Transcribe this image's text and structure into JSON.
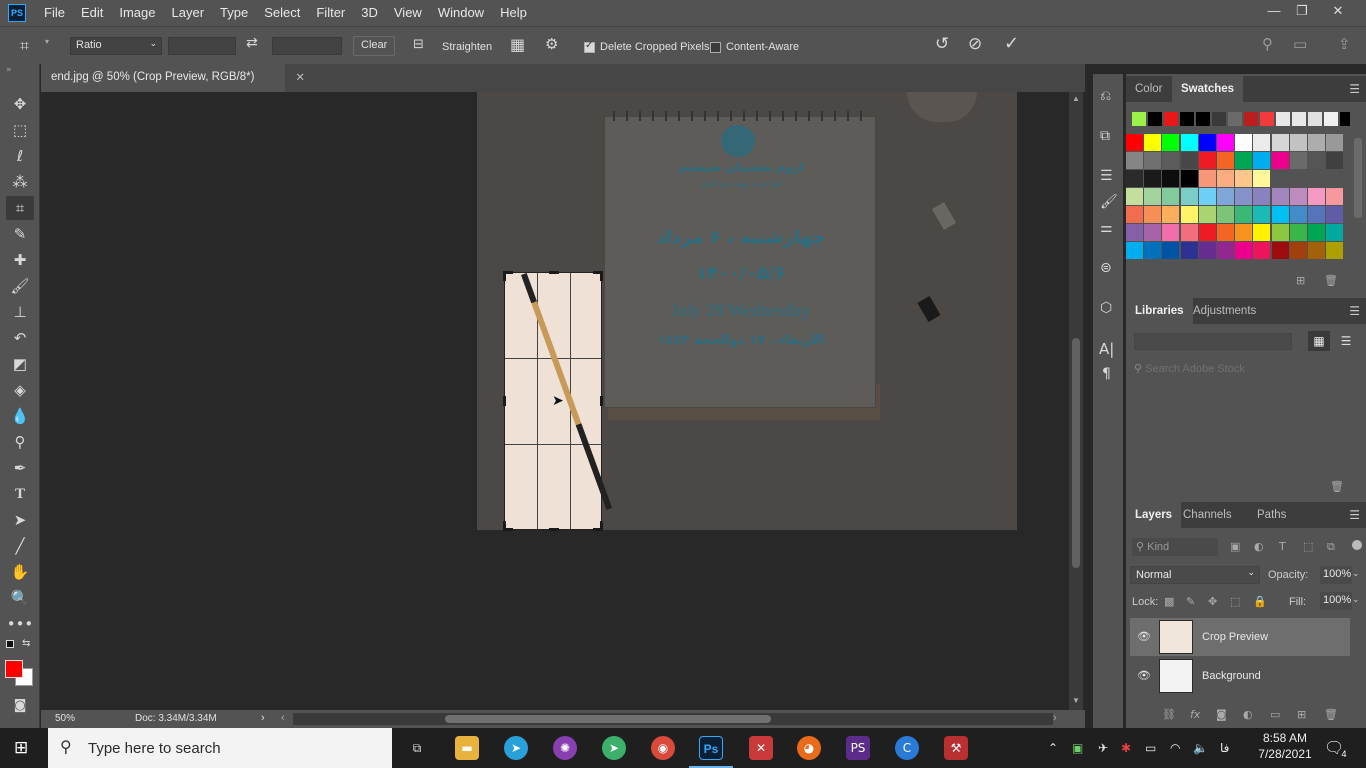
{
  "menubar": {
    "app_icon": "PS",
    "items": [
      "File",
      "Edit",
      "Image",
      "Layer",
      "Type",
      "Select",
      "Filter",
      "3D",
      "View",
      "Window",
      "Help"
    ]
  },
  "options": {
    "ratio_select": "Ratio",
    "width_value": "",
    "height_value": "",
    "clear_label": "Clear",
    "straighten_label": "Straighten",
    "delete_cropped_label": "Delete Cropped Pixels",
    "delete_cropped_checked": true,
    "content_aware_label": "Content-Aware",
    "content_aware_checked": false
  },
  "document": {
    "tab_title": "end.jpg @ 50% (Crop Preview, RGB/8*)",
    "zoom": "50%",
    "doc_info": "Doc: 3.34M/3.34M"
  },
  "image_content": {
    "company_name": "اروم پشتیبان سیستم",
    "company_tagline": "طراحی و تولید نرم افزار",
    "persian_day": "چهارشنبه ، ۶ مرداد",
    "persian_date": "۱۴۰۰/۰۵/۶",
    "english_date": "July 28 Wednesday",
    "arabic_date": "الأربعاء ، ١٧ ذوالحجه ١٤٤٢"
  },
  "panels": {
    "top_tabs": [
      "Color",
      "Swatches"
    ],
    "top_active": "Swatches",
    "mid_tabs": [
      "Libraries",
      "Adjustments"
    ],
    "library_search_placeholder": "Search Adobe Stock",
    "layer_tabs": [
      "Layers",
      "Channels",
      "Paths"
    ],
    "kind_placeholder": "Kind",
    "blend_mode": "Normal",
    "opacity_label": "Opacity:",
    "opacity_value": "100%",
    "lock_label": "Lock:",
    "fill_label": "Fill:",
    "fill_value": "100%",
    "layers": [
      {
        "name": "Crop Preview",
        "selected": true
      },
      {
        "name": "Background",
        "selected": false
      }
    ]
  },
  "swatch_colors": {
    "row1": [
      "#9cf04a",
      "#000000",
      "#e81818",
      "#000000",
      "#000000",
      "#3a3a3a",
      "#6a6a6a",
      "#ba1e1e",
      "#f23a3a",
      "#e8e8e8",
      "#e8e8e8",
      "#e0e0e0",
      "#f0f0f0",
      "#000000",
      "#1a4fb0",
      "#8a8a8a"
    ],
    "row2": [
      "#ff0000",
      "#ffff00",
      "#00ff00",
      "#00ffff",
      "#0000ff",
      "#ff00ff",
      "#ffffff",
      "#ebebeb",
      "#d6d6d6",
      "#c2c2c2",
      "#adadad",
      "#999999"
    ],
    "row3": [
      "#858585",
      "#707070",
      "#5c5c5c",
      "#474747",
      "#ed1c24",
      "#f26522",
      "#00a651",
      "#00aeef",
      "#ec008c",
      "#6a6a6a",
      "#555555",
      "#404040"
    ],
    "row4": [
      "#2b2b2b",
      "#1a1a1a",
      "#0d0d0d",
      "#000000",
      "#f7977a",
      "#f9ad81",
      "#fdc68a",
      "#fff79a"
    ],
    "row5": [
      "#c4df9b",
      "#a3d39c",
      "#82ca9d",
      "#7bcdc8",
      "#6ecff6",
      "#7ea7d8",
      "#8493ca",
      "#8882be",
      "#a187be",
      "#bc8cbf",
      "#f49ac2",
      "#f6989d"
    ],
    "row6": [
      "#f26c4f",
      "#f68e56",
      "#fbaf5c",
      "#fff467",
      "#acd372",
      "#7cc576",
      "#3bb878",
      "#1abbb4",
      "#00bff3",
      "#438cca",
      "#5574b9",
      "#605ca8"
    ],
    "row7": [
      "#855fa8",
      "#a763a8",
      "#f06eaa",
      "#f26d7d",
      "#ed1c24",
      "#f26522",
      "#f7941d",
      "#fff200",
      "#8dc73f",
      "#39b54a",
      "#00a651",
      "#00a99d"
    ],
    "row8": [
      "#00aeef",
      "#0072bc",
      "#0054a6",
      "#2e3192",
      "#662d91",
      "#92278f",
      "#ec008c",
      "#ed145b",
      "#9e0b0f",
      "#a0410d",
      "#a36209",
      "#aba000"
    ]
  },
  "taskbar": {
    "search_placeholder": "Type here to search",
    "time": "8:58 AM",
    "date": "7/28/2021",
    "lang": "فا",
    "notification_count": "4"
  }
}
